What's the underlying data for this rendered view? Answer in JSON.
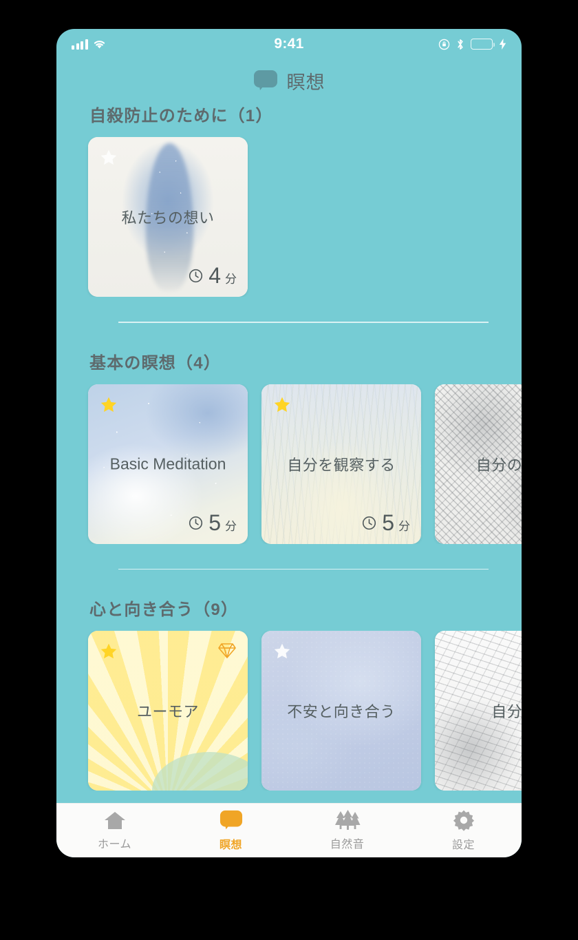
{
  "status_bar": {
    "time": "9:41",
    "signal_icon": "cellular-signal-icon",
    "wifi_icon": "wifi-icon",
    "rotation_lock_icon": "rotation-lock-icon",
    "bluetooth_icon": "bluetooth-icon",
    "battery_icon": "battery-icon",
    "charging_icon": "charging-bolt-icon",
    "battery_color": "#4cd964"
  },
  "header": {
    "title": "瞑想",
    "icon": "speech-bubble-icon",
    "icon_color": "#5e9aa3"
  },
  "theme": {
    "background": "#76ccd4",
    "text": "#5e6a6d",
    "accent": "#f0a526",
    "star_active": "#ffd426",
    "star_inactive": "#ffffff",
    "gem": "#f0a526"
  },
  "sections": [
    {
      "title": "自殺防止のために（1）",
      "cards": [
        {
          "title": "私たちの想い",
          "title_lang": "ja",
          "duration": "4",
          "duration_unit": "分",
          "favorited": false,
          "premium": false,
          "art": "art-feather"
        }
      ]
    },
    {
      "title": "基本の瞑想（4）",
      "cards": [
        {
          "title": "Basic Meditation",
          "title_lang": "en",
          "duration": "5",
          "duration_unit": "分",
          "favorited": true,
          "premium": false,
          "art": "art-snow"
        },
        {
          "title": "自分を観察する",
          "title_lang": "ja",
          "duration": "5",
          "duration_unit": "分",
          "favorited": true,
          "premium": false,
          "art": "art-grass"
        },
        {
          "title": "自分の周り",
          "title_lang": "ja",
          "duration": "",
          "duration_unit": "",
          "favorited": false,
          "premium": false,
          "art": "art-sketch"
        }
      ]
    },
    {
      "title": "心と向き合う（9）",
      "cards": [
        {
          "title": "ユーモア",
          "title_lang": "ja",
          "duration": "",
          "duration_unit": "",
          "favorited": true,
          "premium": true,
          "art": "art-sun"
        },
        {
          "title": "不安と向き合う",
          "title_lang": "ja",
          "duration": "",
          "duration_unit": "",
          "favorited": false,
          "premium": false,
          "art": "art-mist"
        },
        {
          "title": "自分で",
          "title_lang": "ja",
          "duration": "",
          "duration_unit": "",
          "favorited": false,
          "premium": false,
          "art": "art-lineart"
        }
      ]
    }
  ],
  "tabs": [
    {
      "label": "ホーム",
      "icon": "home-icon",
      "active": false
    },
    {
      "label": "瞑想",
      "icon": "speech-bubble-icon",
      "active": true
    },
    {
      "label": "自然音",
      "icon": "trees-icon",
      "active": false
    },
    {
      "label": "設定",
      "icon": "gear-icon",
      "active": false
    }
  ]
}
